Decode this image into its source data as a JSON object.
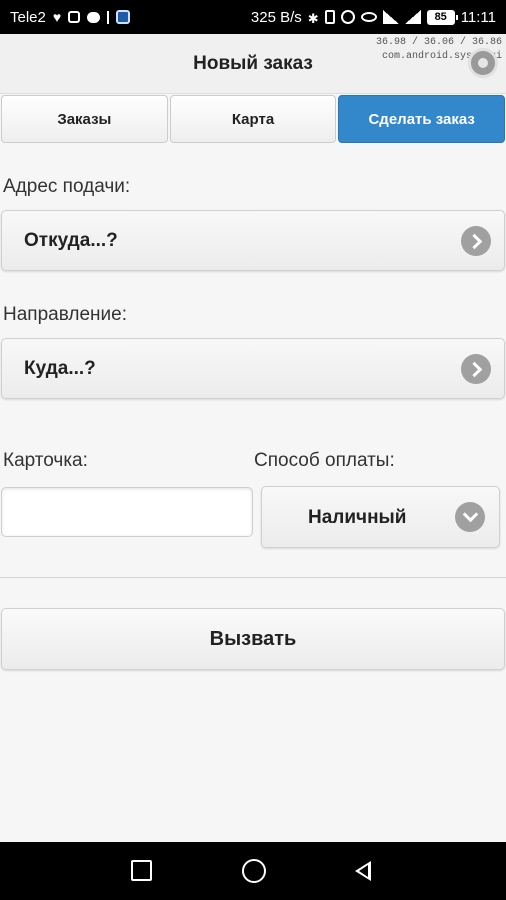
{
  "statusbar": {
    "carrier": "Tele2",
    "net_speed": "325 B/s",
    "battery": "85",
    "time": "11:11"
  },
  "overlay": {
    "line1": "36.98 / 36.06 / 36.86",
    "line2": "com.android.systemui"
  },
  "header": {
    "title": "Новый заказ"
  },
  "tabs": [
    {
      "label": "Заказы"
    },
    {
      "label": "Карта"
    },
    {
      "label": "Сделать заказ",
      "active": true
    }
  ],
  "form": {
    "pickup_label": "Адрес подачи:",
    "pickup_value": "Откуда...?",
    "destination_label": "Направление:",
    "destination_value": "Куда...?",
    "card_label": "Карточка:",
    "card_value": "",
    "payment_label": "Способ оплаты:",
    "payment_value": "Наличный"
  },
  "actions": {
    "call_label": "Вызвать"
  },
  "colors": {
    "accent": "#3388cc",
    "chevron": "#a0a0a0"
  }
}
